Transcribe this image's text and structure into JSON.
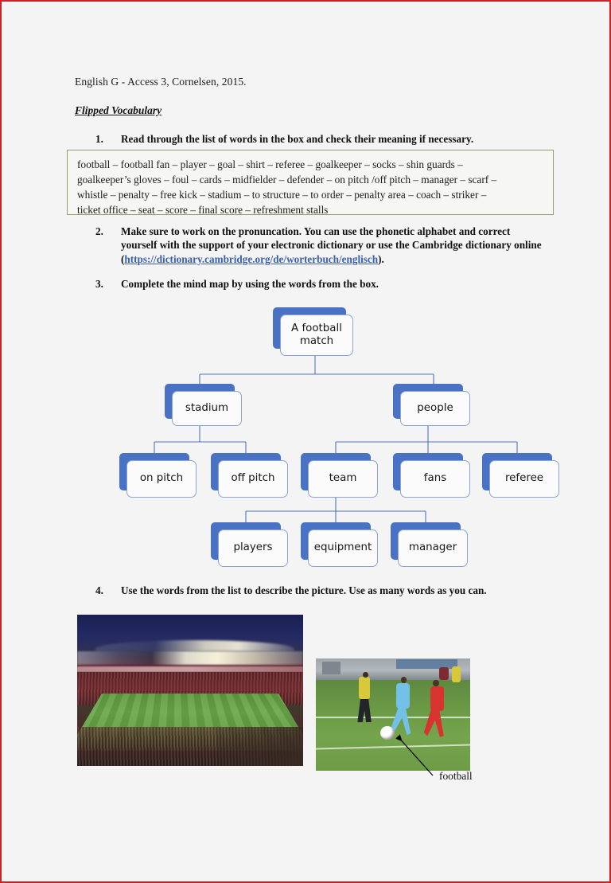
{
  "page": {
    "source_line": "English G - Access 3, Cornelsen, 2015.",
    "section_title": "Flipped Vocabulary",
    "border_color": "#cc2222",
    "background_color": "#f4f4f4"
  },
  "tasks": [
    {
      "number": "1.",
      "text": "Read through the list of words in the box and check their meaning if necessary."
    },
    {
      "number": "2.",
      "text_before_link": "Make sure to work on the pronuncation. You can use the phonetic alphabet and correct yourself with the support of your electronic dictionary or use the Cambridge dictionary online (",
      "link_text": "https://dictionary.cambridge.org/de/worterbuch/englisch",
      "text_after_link": ")."
    },
    {
      "number": "3.",
      "text": "Complete the mind map by using the words from the box."
    },
    {
      "number": "4.",
      "text": "Use the words from the list to describe the picture. Use as many words as you can."
    }
  ],
  "wordbox": {
    "border_color": "#90a070",
    "lines": [
      "football – football fan – player – goal – shirt – referee – goalkeeper – socks – shin guards –",
      "goalkeeper’s gloves – foul – cards – midfielder – defender – on pitch /off pitch – manager – scarf –",
      "whistle – penalty – free kick – stadium – to structure – to order – penalty area – coach  – striker –",
      "ticket office – seat – score – final score – refreshment stalls"
    ],
    "words": [
      "football",
      "football fan",
      "player",
      "goal",
      "shirt",
      "referee",
      "goalkeeper",
      "socks",
      "shin guards",
      "goalkeeper’s gloves",
      "foul",
      "cards",
      "midfielder",
      "defender",
      "on pitch /off pitch",
      "manager",
      "scarf",
      "whistle",
      "penalty",
      "free kick",
      "stadium",
      "to structure",
      "to order",
      "penalty area",
      "coach",
      "striker",
      "ticket office",
      "seat",
      "score",
      "final score",
      "refreshment stalls"
    ]
  },
  "mindmap": {
    "accent_color": "#4a72c4",
    "node_face_color": "#fbfbfb",
    "node_border_color": "#8ba4d6",
    "connector_color": "#5273b8",
    "nodes": {
      "root": "A football match",
      "stadium": "stadium",
      "people": "people",
      "on_pitch": "on pitch",
      "off_pitch": "off pitch",
      "team": "team",
      "fans": "fans",
      "referee": "referee",
      "players": "players",
      "equipment": "equipment",
      "manager": "manager"
    }
  },
  "figures": {
    "stadium_photo_caption": "",
    "match_photo_callout_label": "football"
  },
  "watermark": ""
}
